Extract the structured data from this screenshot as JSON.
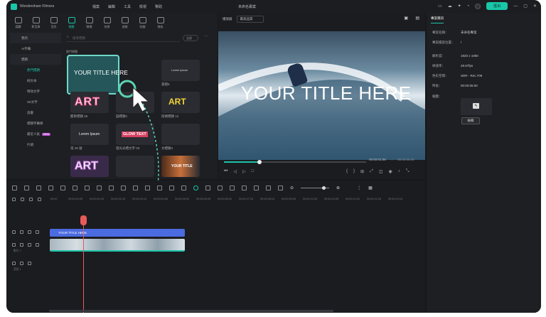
{
  "app": {
    "name": "Wondershare Filmora",
    "doc_title": "未命名專案"
  },
  "menu": [
    "檔案",
    "編輯",
    "工具",
    "檢視",
    "幫助"
  ],
  "export_label": "匯出",
  "toolbar": [
    "媒體",
    "影音庫",
    "音訊",
    "標題",
    "轉場",
    "效果",
    "濾鏡",
    "貼圖",
    "樣板"
  ],
  "sidebar": [
    {
      "label": "我的",
      "type": "cat"
    },
    {
      "label": "AI字幕",
      "type": "item"
    },
    {
      "label": "標題",
      "type": "cat"
    },
    {
      "label": "熱門標題",
      "type": "sub",
      "selected": true
    },
    {
      "label": "純文本",
      "type": "sub"
    },
    {
      "label": "特效文字",
      "type": "sub"
    },
    {
      "label": "3D文字",
      "type": "sub"
    },
    {
      "label": "說書",
      "type": "sub"
    },
    {
      "label": "標題字幕條",
      "type": "sub"
    },
    {
      "label": "最近人氣",
      "type": "sub"
    },
    {
      "label": "片頭",
      "type": "sub"
    }
  ],
  "search_placeholder": "搜尋標題",
  "filter_label": "全部",
  "section_label": "熱門標題",
  "thumbs": {
    "t1": "YOUR TITLE HERE",
    "t2": "Lorem ipsum",
    "t3_label": "基礎6",
    "art": "ART",
    "art_label": "醒目標題 26",
    "art2_label": "圓標題2",
    "art3_label": "街頭標題 12",
    "lorem": "Lorem Ipsum",
    "lorem_label": "常 29 號",
    "glow": "GLOW TEXT",
    "glow_label": "發光光標文字 03",
    "t6_label": "文標題4",
    "art4": "ART",
    "yt": "YOUR TITLE"
  },
  "preview": {
    "player_label": "播放器",
    "quality": "最高品質",
    "title_overlay": "YOUR TITLE HERE",
    "current_time": "00:00:01:08",
    "total_time": "00:00:05:00"
  },
  "props": {
    "tab": "專案資訊",
    "rows": [
      {
        "k": "專案名稱：",
        "v": "未命名專案"
      },
      {
        "k": "專案檔案位置：",
        "v": "/"
      },
      {
        "k": "解析度：",
        "v": "1920 x 1080"
      },
      {
        "k": "幀速率：",
        "v": "29.97fps"
      },
      {
        "k": "色彩空間：",
        "v": "SDR - Rec.709"
      },
      {
        "k": "時長：",
        "v": "00:00:05:00"
      },
      {
        "k": "縮圖：",
        "v": ""
      }
    ],
    "edit_label": "編輯"
  },
  "timeline": {
    "ruler": [
      "00:00",
      "00:00:00:25",
      "00:00:01:20",
      "00:00:02:15",
      "00:00:03:10",
      "00:00:04:05",
      "00:00:05:00",
      "00:00:05:25",
      "00:00:06:20",
      "00:00:07:15",
      "00:00:08:10",
      "00:00:09:05",
      "00:00:10:00",
      "00:00:10:25",
      "00:00:11:20",
      "00:00:12:15",
      "00:00:13:10"
    ],
    "title_clip": "YOUR TITLE HERE",
    "video_label": "影片 1",
    "audio_label": "音訊 1"
  },
  "colors": {
    "accent": "#19c6a7",
    "title_clip": "#4b6be0",
    "playhead": "#e85a5a"
  }
}
